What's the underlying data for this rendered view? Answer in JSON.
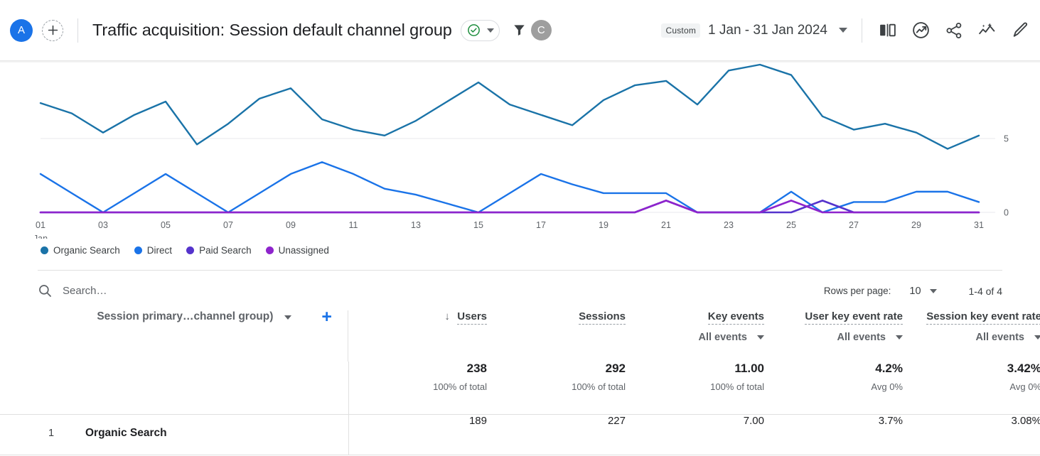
{
  "header": {
    "account_avatar": "A",
    "account_avatar_color": "#1a73e8",
    "add_icon": "plus-icon",
    "title": "Traffic acquisition: Session default channel group",
    "verified_icon": "check-circle-icon",
    "verified_color": "#1e8e3e",
    "filter_icon": "funnel-icon",
    "user_avatar": "C",
    "user_avatar_color": "#9e9e9e",
    "date_tag": "Custom",
    "date_range": "1 Jan - 31 Jan 2024",
    "tools": [
      {
        "name": "compare-icon",
        "label": "Compare"
      },
      {
        "name": "insights-icon",
        "label": "Insights"
      },
      {
        "name": "share-icon",
        "label": "Share"
      },
      {
        "name": "trend-sparkle-icon",
        "label": "Trends"
      },
      {
        "name": "edit-pencil-icon",
        "label": "Edit"
      }
    ]
  },
  "chart_data": {
    "type": "line",
    "title": "",
    "xlabel": "Jan",
    "ylabel": "",
    "ylim": [
      0,
      10
    ],
    "y_ticks": [
      0,
      5
    ],
    "y_axis_position": "right",
    "grid": true,
    "legend_position": "bottom",
    "x_axis_caption": "Jan",
    "x": [
      1,
      2,
      3,
      4,
      5,
      6,
      7,
      8,
      9,
      10,
      11,
      12,
      13,
      14,
      15,
      16,
      17,
      18,
      19,
      20,
      21,
      22,
      23,
      24,
      25,
      26,
      27,
      28,
      29,
      30,
      31
    ],
    "tick_labels": [
      "01",
      "03",
      "05",
      "07",
      "09",
      "11",
      "13",
      "15",
      "17",
      "19",
      "21",
      "23",
      "25",
      "27",
      "29",
      "31"
    ],
    "series": [
      {
        "name": "Organic Search",
        "color": "#1a73a8",
        "values": [
          7.4,
          6.7,
          5.4,
          6.6,
          7.5,
          4.6,
          6.0,
          7.7,
          8.4,
          6.3,
          5.6,
          5.2,
          6.2,
          7.5,
          8.8,
          7.3,
          6.6,
          5.9,
          7.6,
          8.6,
          8.9,
          7.3,
          9.6,
          10.0,
          9.3,
          6.5,
          5.6,
          6.0,
          5.4,
          4.3,
          5.2
        ]
      },
      {
        "name": "Direct",
        "color": "#1a73e8",
        "values": [
          2.6,
          1.3,
          0.0,
          1.3,
          2.6,
          1.3,
          0.0,
          1.3,
          2.6,
          3.4,
          2.6,
          1.6,
          1.2,
          0.6,
          0.0,
          1.3,
          2.6,
          1.9,
          1.3,
          1.3,
          1.3,
          0.0,
          0.0,
          0.0,
          1.4,
          0.0,
          0.7,
          0.7,
          1.4,
          1.4,
          0.7
        ]
      },
      {
        "name": "Paid Search",
        "color": "#5533cc",
        "values": [
          0,
          0,
          0,
          0,
          0,
          0,
          0,
          0,
          0,
          0,
          0,
          0,
          0,
          0,
          0,
          0,
          0,
          0,
          0,
          0,
          0.8,
          0,
          0,
          0,
          0,
          0.8,
          0,
          0,
          0,
          0,
          0
        ]
      },
      {
        "name": "Unassigned",
        "color": "#8e24cc",
        "values": [
          0,
          0,
          0,
          0,
          0,
          0,
          0,
          0,
          0,
          0,
          0,
          0,
          0,
          0,
          0,
          0,
          0,
          0,
          0,
          0,
          0.8,
          0,
          0,
          0,
          0.8,
          0,
          0,
          0,
          0,
          0,
          0
        ]
      }
    ]
  },
  "legend": [
    {
      "label": "Organic Search",
      "color": "#1a73a8"
    },
    {
      "label": "Direct",
      "color": "#1a73e8"
    },
    {
      "label": "Paid Search",
      "color": "#5533cc"
    },
    {
      "label": "Unassigned",
      "color": "#8e24cc"
    }
  ],
  "search": {
    "placeholder": "Search…",
    "icon": "search-icon"
  },
  "pagination": {
    "rows_label": "Rows per page:",
    "rows_value": "10",
    "range": "1-4 of 4"
  },
  "table": {
    "dimension_header": "Session primary…channel group)",
    "add_dimension_icon": "plus-icon",
    "columns": [
      {
        "title": "Users",
        "sorted": true,
        "subtitle": ""
      },
      {
        "title": "Sessions",
        "sorted": false,
        "subtitle": ""
      },
      {
        "title": "Key events",
        "sorted": false,
        "subtitle": "All events"
      },
      {
        "title": "User key event rate",
        "sorted": false,
        "subtitle": "All events"
      },
      {
        "title": "Session key event rate",
        "sorted": false,
        "subtitle": "All events"
      }
    ],
    "totals": {
      "values": [
        "238",
        "292",
        "11.00",
        "4.2%",
        "3.42%"
      ],
      "subs": [
        "100% of total",
        "100% of total",
        "100% of total",
        "Avg 0%",
        "Avg 0%"
      ]
    },
    "rows": [
      {
        "rank": "1",
        "dimension": "Organic Search",
        "values": [
          "189",
          "227",
          "7.00",
          "3.7%",
          "3.08%"
        ]
      }
    ]
  }
}
